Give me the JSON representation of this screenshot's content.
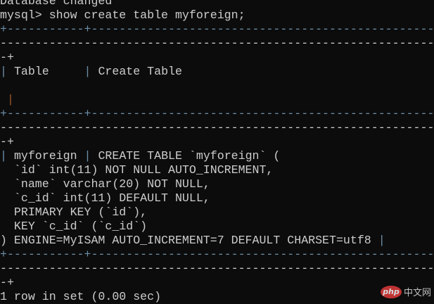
{
  "terminal": {
    "line_db_changed": "Database changed",
    "prompt": "mysql> show create table myforeign;",
    "sep_top": "+-----------+--------------------------------------------------",
    "sep_dashes": "--------------------------------------------------------------",
    "sep_end": "-+",
    "header_table": "Table",
    "header_create": "Create Table",
    "row_table": "myforeign",
    "ddl": [
      "CREATE TABLE `myforeign` (",
      "  `id` int(11) NOT NULL AUTO_INCREMENT,",
      "  `name` varchar(20) NOT NULL,",
      "  `c_id` int(11) DEFAULT NULL,",
      "  PRIMARY KEY (`id`),",
      "  KEY `c_id` (`c_id`)",
      ") ENGINE=MyISAM AUTO_INCREMENT=7 DEFAULT CHARSET=utf8"
    ],
    "result": "1 row in set (0.00 sec)"
  },
  "watermark": {
    "logo": "php",
    "text": "中文网"
  }
}
